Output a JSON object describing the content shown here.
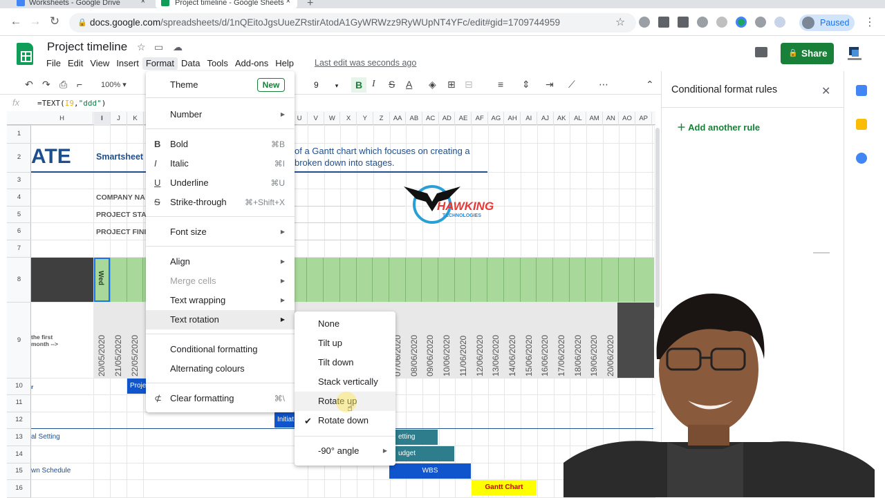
{
  "browser": {
    "tabs": [
      {
        "title": "Worksheets - Google Drive",
        "close": "×"
      },
      {
        "title": "Project timeline - Google Sheets",
        "close": "×"
      }
    ],
    "new_tab": "+",
    "url_host": "docs.google.com",
    "url_path": "/spreadsheets/d/1nQEitoJgsUueZRstirAtodA1GyWRWzz9RyWUpNT4YFc/edit#gid=1709744959",
    "profile_status": "Paused"
  },
  "doc": {
    "title": "Project timeline",
    "menus": [
      "File",
      "Edit",
      "View",
      "Insert",
      "Format",
      "Data",
      "Tools",
      "Add-ons",
      "Help"
    ],
    "last_edit": "Last edit was seconds ago",
    "share_label": "Share"
  },
  "toolbar": {
    "zoom": "100%",
    "font_size": "9",
    "bold": "B",
    "italic": "I",
    "strike": "S",
    "text_color": "A"
  },
  "formula_bar": {
    "fx": "fx",
    "prefix": "=TEXT(",
    "ref": "I9",
    "comma": ",",
    "fmt": "\"ddd\"",
    "suffix": ")"
  },
  "columns": [
    "H",
    "I",
    "J",
    "K",
    "U",
    "V",
    "W",
    "X",
    "Y",
    "Z",
    "AA",
    "AB",
    "AC",
    "AD",
    "AE",
    "AF",
    "AG",
    "AH",
    "AI",
    "AJ",
    "AK",
    "AL",
    "AM",
    "AN",
    "AO",
    "AP"
  ],
  "rows": [
    "1",
    "2",
    "3",
    "4",
    "5",
    "6",
    "7",
    "8",
    "9",
    "10",
    "11",
    "12",
    "13",
    "14",
    "15",
    "16"
  ],
  "sheet": {
    "big_title": "ATE",
    "smartsheet": "Smartsheet",
    "desc_line1": "of a Gantt chart which focuses on creating a",
    "desc_line2": "broken down into stages.",
    "company_label": "COMPANY NA",
    "project_start_label": "PROJECT STA",
    "project_finish_label": "PROJECT FINI",
    "logo_text": "HAWKING",
    "logo_sub": "TECHNOLOGIES",
    "wed": "Wed",
    "row9_label_1": "the first",
    "row9_label_2": "month -->",
    "row10_label": "r",
    "dates_left": [
      "20/05/2020",
      "21/05/2020",
      "22/05/2020"
    ],
    "dates_right": [
      "07/06/2020",
      "08/06/2020",
      "09/06/2020",
      "10/06/2020",
      "11/06/2020",
      "12/06/2020",
      "13/06/2020",
      "14/06/2020",
      "15/06/2020",
      "16/06/2020",
      "17/06/2020",
      "18/06/2020",
      "19/06/2020",
      "20/06/2020"
    ],
    "row13_label": "al Setting",
    "row15_label": "wn Schedule",
    "bar_project": "Proje",
    "bar_initiation": "Initiat",
    "bar_setting": "etting",
    "bar_budget": "udget",
    "bar_wbs": "WBS",
    "bar_gantt": "Gantt Chart"
  },
  "format_menu": {
    "theme": "Theme",
    "theme_badge": "New",
    "number": "Number",
    "bold": "Bold",
    "bold_sc": "⌘B",
    "italic": "Italic",
    "italic_sc": "⌘I",
    "underline": "Underline",
    "underline_sc": "⌘U",
    "strike": "Strike-through",
    "strike_sc": "⌘+Shift+X",
    "font_size": "Font size",
    "align": "Align",
    "merge": "Merge cells",
    "wrapping": "Text wrapping",
    "rotation": "Text rotation",
    "conditional": "Conditional formatting",
    "alternating": "Alternating colours",
    "clear": "Clear formatting",
    "clear_sc": "⌘\\"
  },
  "rotation_submenu": [
    "None",
    "Tilt up",
    "Tilt down",
    "Stack vertically",
    "Rotate up",
    "Rotate down",
    "-90° angle"
  ],
  "panel": {
    "title": "Conditional format rules",
    "add_rule": "Add another rule"
  },
  "colors": {
    "sheets_green": "#0f9d58",
    "share_green": "#188038",
    "header_blue": "#1f4e8c",
    "row8_green": "#a8d89a",
    "bar_blue": "#1155cc",
    "bar_teal": "#2e7d8c",
    "bar_yellow": "#ffff00"
  }
}
